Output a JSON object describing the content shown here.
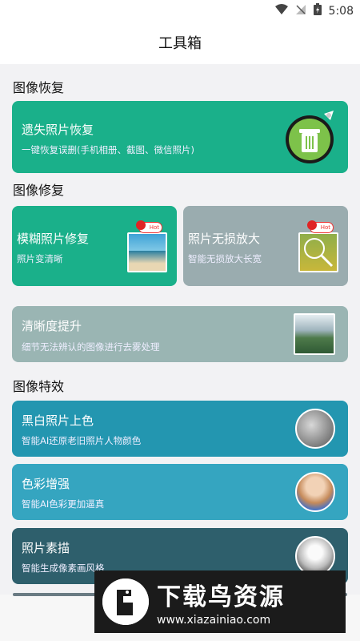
{
  "status": {
    "time": "5:08"
  },
  "header": {
    "title": "工具箱"
  },
  "sections": {
    "recovery": {
      "title": "图像恢复"
    },
    "repair": {
      "title": "图像修复"
    },
    "effects": {
      "title": "图像特效"
    }
  },
  "cards": {
    "lost_photo": {
      "title": "遗失照片恢复",
      "subtitle": "一键恢复误删(手机相册、截图、微信照片)",
      "color": "#1ab08a"
    },
    "blur_fix": {
      "title": "模糊照片修复",
      "subtitle": "照片变清晰",
      "badge": "Hot",
      "color": "#1ab08a"
    },
    "lossless_zoom": {
      "title": "照片无损放大",
      "subtitle": "智能无损放大长宽",
      "badge": "Hot",
      "color": "#9aacaf"
    },
    "clarity": {
      "title": "清晰度提升",
      "subtitle": "细节无法辨认的图像进行去雾处理",
      "color": "#9ab5b3"
    },
    "colorize": {
      "title": "黑白照片上色",
      "subtitle": "智能AI还原老旧照片人物颜色",
      "color": "#2396b0"
    },
    "color_enhance": {
      "title": "色彩增强",
      "subtitle": "智能AI色彩更加逼真",
      "color": "#35a5c0"
    },
    "sketch": {
      "title": "照片素描",
      "subtitle": "智能生成像素画风格",
      "color": "#2e5f6c"
    }
  },
  "watermark": {
    "main": "下载鸟资源",
    "url": "www.xiazainiao.com"
  }
}
